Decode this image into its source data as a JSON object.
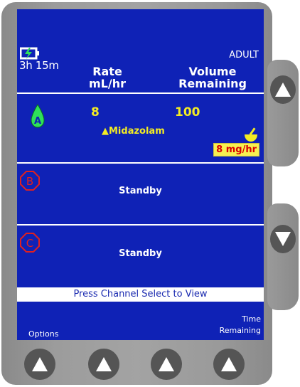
{
  "status": {
    "battery_icon": "battery-charging-icon",
    "runtime": "3h 15m",
    "profile": "ADULT"
  },
  "columns": {
    "rate_label": "Rate",
    "rate_unit": "mL/hr",
    "volume_label": "Volume",
    "volume_sub": "Remaining"
  },
  "channels": [
    {
      "id": "A",
      "icon": "channel-a-drop-icon",
      "rate": "8",
      "volume": "100",
      "drug": "▲Midazolam",
      "dose": "8 mg/hr",
      "dose_icon": "mortar-pestle-icon"
    },
    {
      "id": "B",
      "icon": "channel-b-octagon-icon",
      "status": "Standby"
    },
    {
      "id": "C",
      "icon": "channel-c-octagon-icon",
      "status": "Standby"
    }
  ],
  "banner": "Press Channel Select to View",
  "softkeys": {
    "left": "Options",
    "right_line1": "Time",
    "right_line2": "Remaining"
  },
  "colors": {
    "screen_bg": "#0f22b6",
    "highlight_text": "#f3ec23",
    "channel_a": "#2fe05a",
    "standby_channel": "#e02020",
    "dose_box_bg": "#f8f050",
    "dose_text": "#d80000"
  }
}
